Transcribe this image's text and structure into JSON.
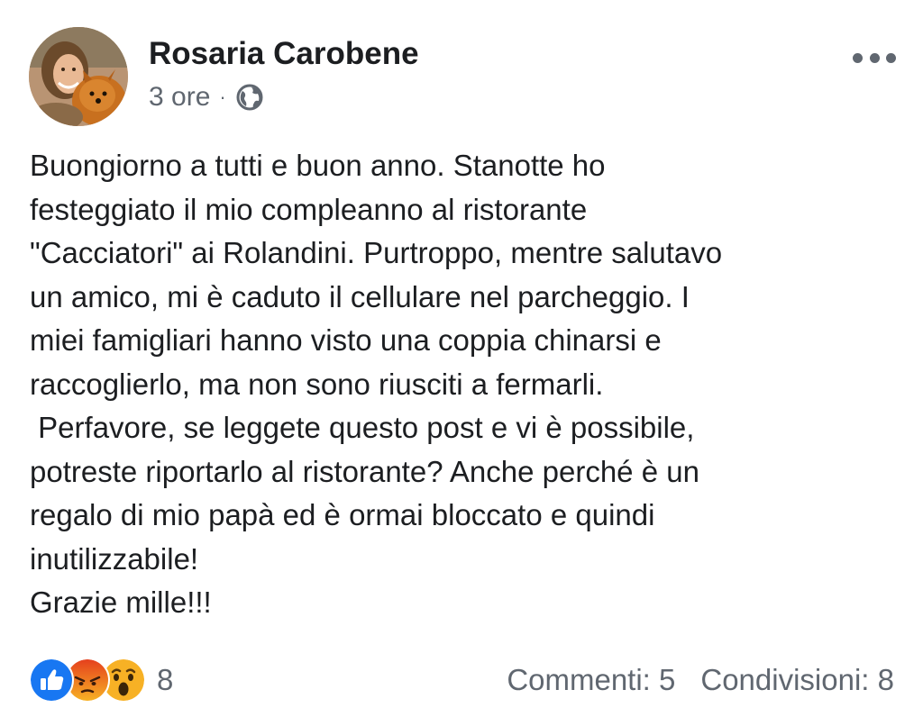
{
  "post": {
    "author": "Rosaria Carobene",
    "time": "3 ore",
    "separator": "·",
    "privacy_icon": "globe-icon",
    "more_icon": "more-horizontal-icon",
    "text_lines": [
      "Buongiorno a tutti e buon anno. Stanotte ho",
      "festeggiato il mio compleanno al ristorante",
      "\"Cacciatori\" ai Rolandini. Purtroppo, mentre salutavo",
      "un amico, mi è caduto il cellulare nel parcheggio. I",
      "miei famigliari hanno visto una coppia chinarsi e",
      "raccoglierlo, ma non sono riusciti a fermarli.",
      " Perfavore, se leggete questo post e vi è possibile,",
      "potreste riportarlo al ristorante? Anche perché è un",
      "regalo di mio papà ed è ormai bloccato e quindi",
      "inutilizzabile!",
      "Grazie mille!!!"
    ]
  },
  "footer": {
    "reactions": [
      "like-icon",
      "angry-icon",
      "wow-icon"
    ],
    "reaction_count": "8",
    "comments": "Commenti: 5",
    "shares": "Condivisioni: 8"
  },
  "colors": {
    "text": "#1c1e21",
    "secondary": "#606770",
    "like_blue": "#1877f2",
    "angry_orange": "#e9710f",
    "wow_yellow": "#f7b125"
  }
}
